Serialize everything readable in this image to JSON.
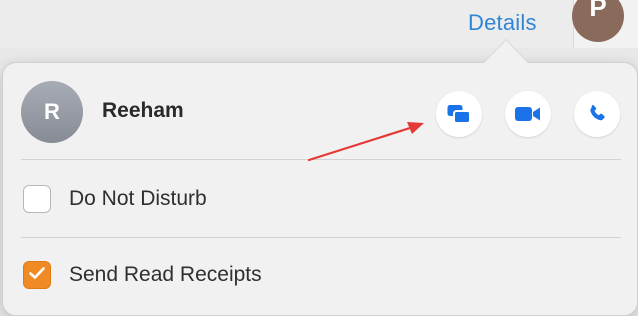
{
  "header": {
    "details_label": "Details",
    "avatar_initial": "P"
  },
  "popover": {
    "contact": {
      "avatar_initial": "R",
      "name": "Reeham"
    },
    "actions": [
      {
        "icon": "screen-share-icon"
      },
      {
        "icon": "video-camera-icon"
      },
      {
        "icon": "phone-icon"
      }
    ],
    "options": [
      {
        "label": "Do Not Disturb",
        "checked": false
      },
      {
        "label": "Send Read Receipts",
        "checked": true
      }
    ]
  },
  "colors": {
    "accent_blue": "#2f86d6",
    "icon_blue": "#1a73e8",
    "checkbox_orange": "#f08a24",
    "annotation_red": "#e53935"
  }
}
